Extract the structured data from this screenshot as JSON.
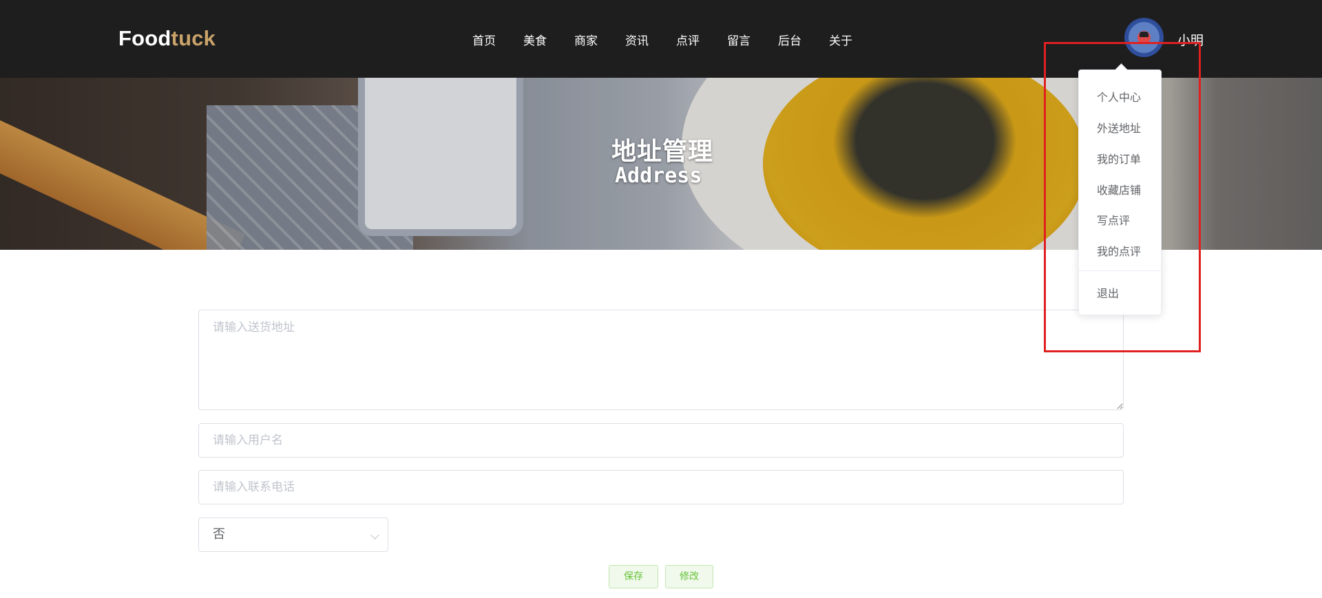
{
  "header": {
    "logo_part1": "Food",
    "logo_part2": "tuck",
    "nav": [
      "首页",
      "美食",
      "商家",
      "资讯",
      "点评",
      "留言",
      "后台",
      "关于"
    ],
    "username": "小明"
  },
  "banner": {
    "title": "地址管理",
    "subtitle": "Address"
  },
  "form": {
    "address_placeholder": "请输入送货地址",
    "name_placeholder": "请输入用户名",
    "phone_placeholder": "请输入联系电话",
    "default_select_value": "否",
    "save_label": "保存",
    "edit_label": "修改"
  },
  "user_menu": {
    "items": [
      "个人中心",
      "外送地址",
      "我的订单",
      "收藏店铺",
      "写点评",
      "我的点评"
    ],
    "logout": "退出"
  },
  "colors": {
    "header_bg": "#1e1e1e",
    "logo_accent": "#c9a36a",
    "success_text": "#67c23a",
    "highlight_border": "#e02020"
  }
}
